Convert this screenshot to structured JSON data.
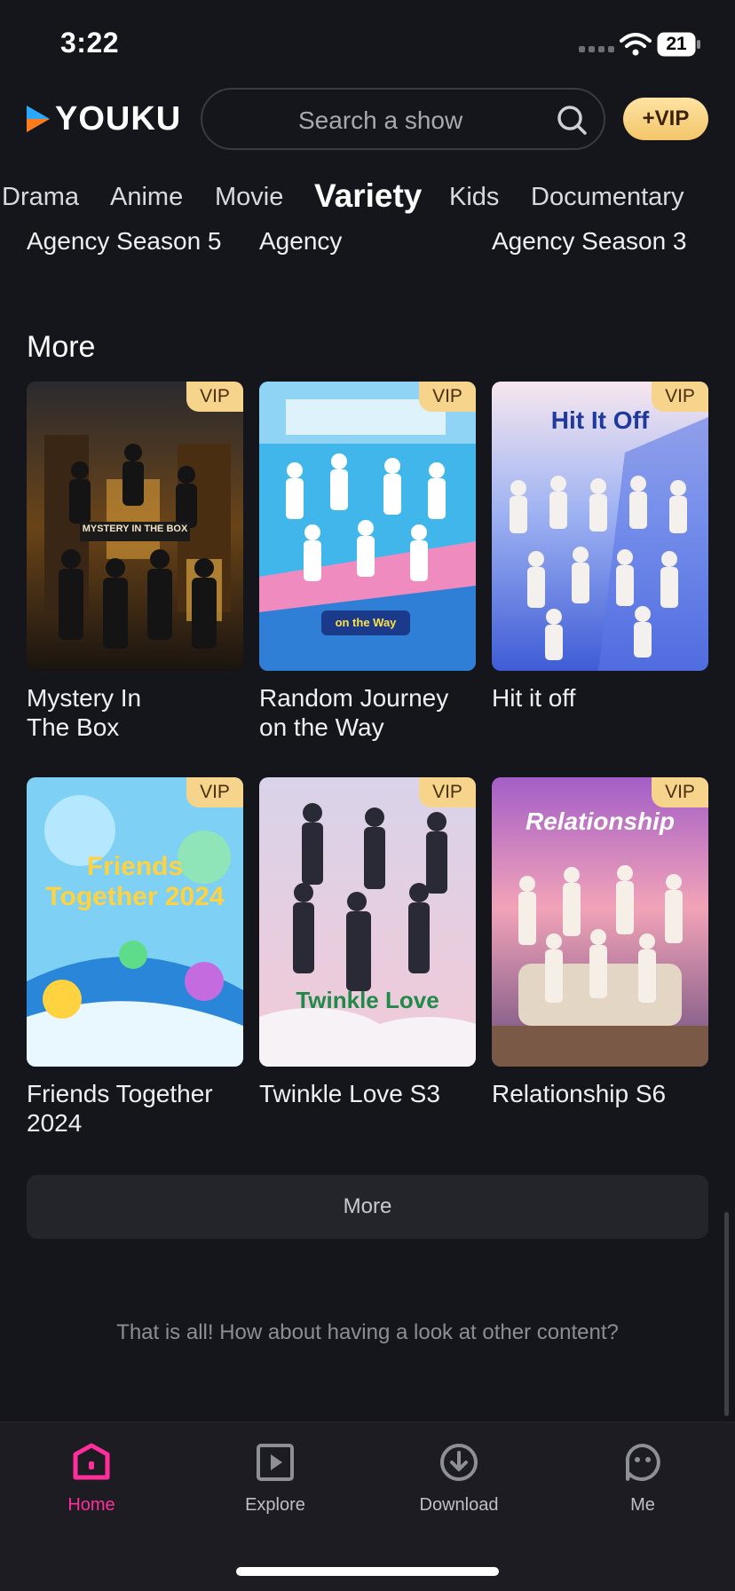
{
  "status_bar": {
    "time": "3:22",
    "battery": "21"
  },
  "header": {
    "logo_text": "YOUKU",
    "search_placeholder": "Search a show",
    "vip_button": "+VIP"
  },
  "tabs": [
    "Drama",
    "Anime",
    "Movie",
    "Variety",
    "Kids",
    "Documentary"
  ],
  "active_tab": "Variety",
  "previous_row_titles": [
    "Agency Season 5",
    "Agency",
    "Agency Season 3"
  ],
  "section": {
    "title": "More",
    "vip_badge": "VIP",
    "cards": [
      {
        "title": "Mystery In The Box",
        "line1": "Mystery In",
        "line2": "The Box",
        "poster_text": "MYSTERY IN THE BOX"
      },
      {
        "title": "Random Journey on the Way",
        "line1": "Random Journey",
        "line2": "on the Way",
        "poster_text": "on the Way"
      },
      {
        "title": "Hit it off",
        "line1": "Hit it off",
        "line2": "",
        "poster_text": "Hit It Off"
      },
      {
        "title": "Friends Together 2024",
        "line1": "Friends Together",
        "line2": "2024",
        "poster_text": "Friends Together 2024"
      },
      {
        "title": "Twinkle Love S3",
        "line1": "Twinkle Love S3",
        "line2": "",
        "poster_text": "Twinkle Love"
      },
      {
        "title": "Relationship S6",
        "line1": "Relationship S6",
        "line2": "",
        "poster_text": "Relationship"
      }
    ]
  },
  "more_button": "More",
  "end_message": "That is all! How about having a look at other content?",
  "bottom_nav": [
    {
      "label": "Home",
      "icon": "home-icon",
      "active": true
    },
    {
      "label": "Explore",
      "icon": "play-square-icon",
      "active": false
    },
    {
      "label": "Download",
      "icon": "download-icon",
      "active": false
    },
    {
      "label": "Me",
      "icon": "face-icon",
      "active": false
    }
  ],
  "colors": {
    "accent": "#ff2e9a",
    "vip_gold": "#f6d48b",
    "background": "#15151c",
    "logo_blue": "#2aa8ff"
  }
}
